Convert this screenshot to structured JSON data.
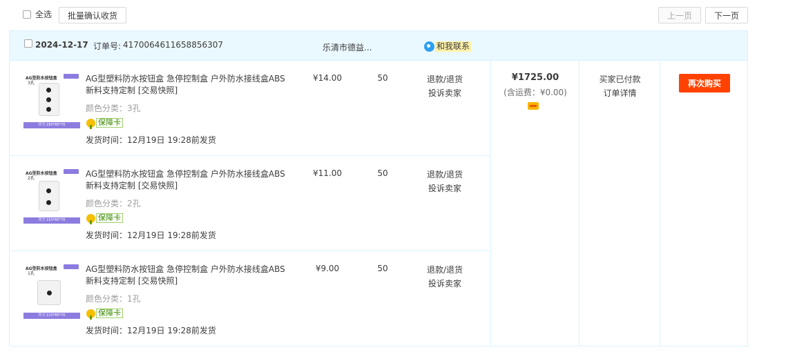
{
  "toolbar": {
    "select_all_label": "全选",
    "batch_confirm_label": "批量确认收货",
    "prev_page_label": "上一页",
    "next_page_label": "下一页"
  },
  "order": {
    "date": "2024-12-17",
    "order_no_label": "订单号:",
    "order_no": "4170064611658856307",
    "shop_name": "乐清市德益...",
    "contact_label": "和我联系",
    "items": [
      {
        "title": "AG型塑料防水按钮盒 急停控制盒 户外防水接线盒ABS新料支持定制 [交易快照]",
        "spec": "颜色分类：3孔",
        "guarantee": "保障卡",
        "ship_time": "发货时间：12月19日 19:28前发货",
        "price": "¥14.00",
        "qty": "50",
        "op_refund": "退款/退货",
        "op_complain": "投诉卖家",
        "thumb_title": "AG型防水按钮盒",
        "thumb_sub": "3孔",
        "thumb_size": "尺寸:180*80*70",
        "holes": 3
      },
      {
        "title": "AG型塑料防水按钮盒 急停控制盒 户外防水接线盒ABS新料支持定制 [交易快照]",
        "spec": "颜色分类：2孔",
        "guarantee": "保障卡",
        "ship_time": "发货时间：12月19日 19:28前发货",
        "price": "¥11.00",
        "qty": "50",
        "op_refund": "退款/退货",
        "op_complain": "投诉卖家",
        "thumb_title": "AG型防水按钮盒",
        "thumb_sub": "2孔",
        "thumb_size": "尺寸:150*80*70",
        "holes": 2
      },
      {
        "title": "AG型塑料防水按钮盒 急停控制盒 户外防水接线盒ABS新料支持定制 [交易快照]",
        "spec": "颜色分类：1孔",
        "guarantee": "保障卡",
        "ship_time": "发货时间：12月19日 19:28前发货",
        "price": "¥9.00",
        "qty": "50",
        "op_refund": "退款/退货",
        "op_complain": "投诉卖家",
        "thumb_title": "AG型防水按钮盒",
        "thumb_sub": "1孔",
        "thumb_size": "尺寸:110*80*70",
        "holes": 1
      }
    ],
    "total": "¥1725.00",
    "freight": "(含运费：¥0.00)",
    "status": "买家已付款",
    "detail_label": "订单详情",
    "rebuy_label": "再次购买"
  },
  "colors": {
    "accent": "#ff4200",
    "header_bg": "#eaf8ff",
    "border": "#daf3ff",
    "thumb_bar": "#8d7cdf"
  }
}
